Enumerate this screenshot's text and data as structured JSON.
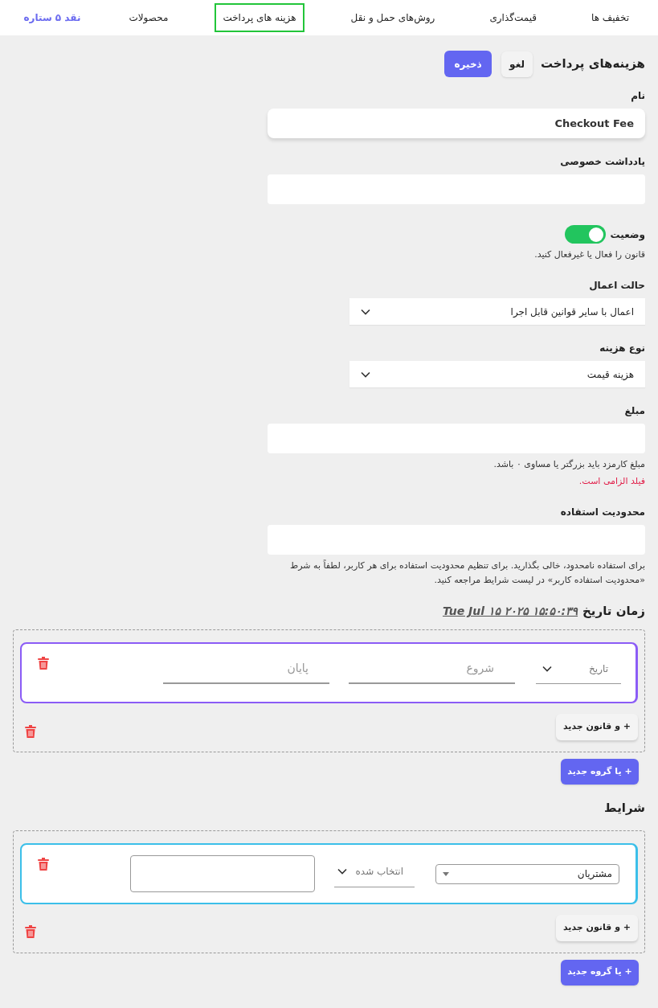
{
  "tabs": [
    {
      "label": "تخفیف ها",
      "kind": "tab",
      "selected": false
    },
    {
      "label": "قیمت‌گذاری",
      "kind": "tab",
      "selected": false
    },
    {
      "label": "روش‌های حمل و نقل",
      "kind": "tab",
      "selected": false
    },
    {
      "label": "هزینه های پرداخت",
      "kind": "tab",
      "selected": true
    },
    {
      "label": "محصولات",
      "kind": "tab",
      "selected": false
    },
    {
      "label": "نقد ۵ ستاره",
      "kind": "link"
    }
  ],
  "header": {
    "title": "هزینه‌های پرداخت",
    "cancel": "لغو",
    "save": "ذخیره"
  },
  "fields": [
    {
      "kind": "text",
      "label": "نام",
      "value": "Checkout Fee",
      "raised": true
    },
    {
      "kind": "text",
      "label": "یادداشت خصوصی"
    },
    {
      "kind": "toggle",
      "label": "وضعیت",
      "on": true,
      "hint": "قانون را فعال یا غیرفعال کنید."
    },
    {
      "kind": "select",
      "label": "حالت اعمال",
      "value": "اعمال با سایر قوانین قابل اجرا"
    },
    {
      "kind": "select",
      "label": "نوع هزینه",
      "value": "هزینه قیمت"
    },
    {
      "kind": "text",
      "label": "مبلغ",
      "hint": "مبلغ کارمزد باید بزرگتر یا مساوی ۰ باشد.",
      "error": "فیلد الزامی است."
    },
    {
      "kind": "text",
      "label": "محدودیت استفاده",
      "hint": "برای استفاده نامحدود، خالی بگذارید. برای تنظیم محدودیت استفاده برای هر کاربر، لطفاً به شرط «محدودیت استفاده کاربر» در لیست شرایط مراجعه کنید."
    }
  ],
  "schedule": {
    "title": "زمان تاریخ",
    "date": "Tue Jul ۱۵ ۲۰۲۵ ۱۵:۵۰:۳۹",
    "rule": {
      "select": "تاریخ",
      "start_placeholder": "شروع",
      "end_placeholder": "پایان"
    },
    "and_button": "+ و قانون جدید",
    "or_button": "+ یا گروه جدید"
  },
  "conditions": {
    "title": "شرایط",
    "rule": {
      "select": "مشتریان",
      "operator_placeholder": "انتخاب شده"
    },
    "and_button": "+ و قانون جدید",
    "or_button": "+ یا گروه جدید"
  }
}
